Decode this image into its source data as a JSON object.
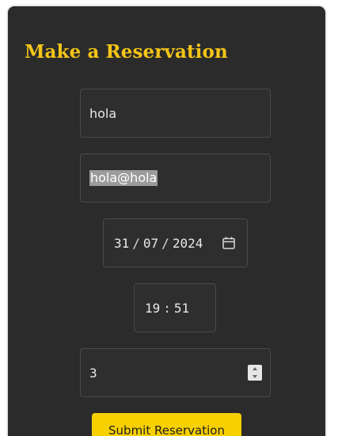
{
  "form": {
    "title": "Make a Reservation",
    "name": {
      "value": "hola"
    },
    "email": {
      "value": "hola@hola",
      "selected": true
    },
    "date": {
      "day": "31",
      "month": "07",
      "year": "2024",
      "separator": "/"
    },
    "time": {
      "hour": "19",
      "minute": "51",
      "separator": ":"
    },
    "guests": {
      "value": "3"
    },
    "submit_label": "Submit Reservation"
  },
  "colors": {
    "card_background": "#2b2b2b",
    "title": "#f5c518",
    "button": "#f7d000",
    "field_border": "#4a4a4a",
    "selection": "#9b9b9b"
  },
  "icons": {
    "date_picker": "calendar-icon",
    "guests_spinner": "spinner-arrows-icon"
  }
}
